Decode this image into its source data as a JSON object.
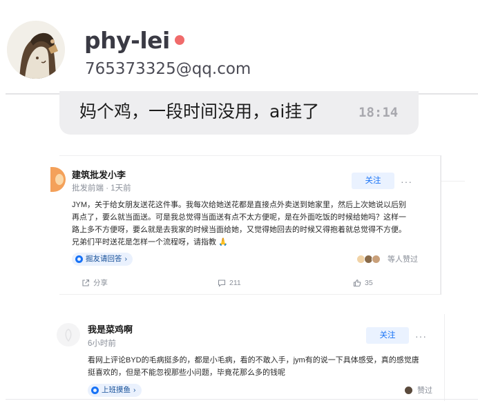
{
  "profile": {
    "username": "phy-lei",
    "email": "765373325@qq.com",
    "status_color": "#f06b6b"
  },
  "message": {
    "text": "妈个鸡，一段时间没用，ai挂了",
    "time": "18:14"
  },
  "posts": [
    {
      "author": "建筑批发小李",
      "meta": "批发前端 · 1天前",
      "follow_label": "关注",
      "more_label": "···",
      "body_lines": [
        "JYM，关于给女朋友送花这件事。我每次给她送花都是直接点外卖送到她家里，然后上次她说以后别",
        "再点了，要么就当面送。可是我总觉得当面送有点不太方便呢，是在外面吃饭的时候给她吗？这样一",
        "路上多不方便呀，要么就是去我家的时候当面给她，又觉得她回去的时候又得抱着就总觉得不方便。",
        "兄弟们平时送花是怎样一个流程呀，请指教 🙏"
      ],
      "tag_label": "掘友请回答",
      "liked_label": "等人赞过",
      "share_label": "分享",
      "comment_count": "211",
      "like_count": "35"
    },
    {
      "author": "我是菜鸡啊",
      "meta": "6小时前",
      "follow_label": "关注",
      "more_label": "···",
      "body_lines": [
        "看网上评论BYD的毛病挺多的，都是小毛病，看的不敢入手，jym有的说一下具体感受，真的感觉唐",
        "挺喜欢的，但是不能忽视那些小问题，毕竟花那么多的钱呢"
      ],
      "tag_label": "上班摸鱼",
      "liked_label": "赞过"
    }
  ],
  "icons": {
    "share": "share-icon",
    "comment": "comment-icon",
    "like": "thumbs-up-icon",
    "tag": "circle-icon",
    "arrow": "chevron-right-icon"
  },
  "accent_color": "#1772f6"
}
